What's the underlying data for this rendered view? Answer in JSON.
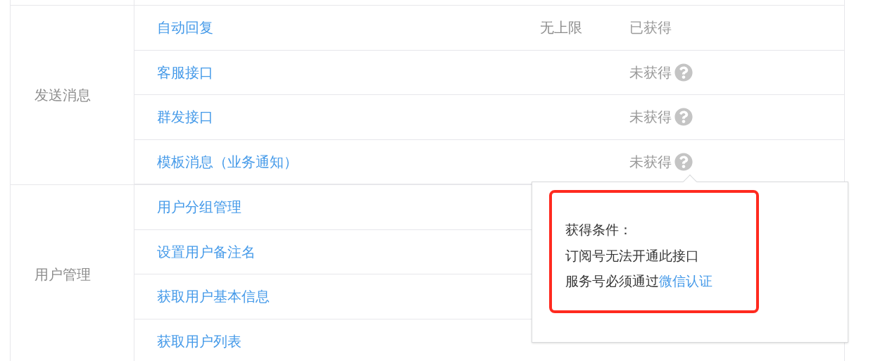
{
  "groups": [
    {
      "category": "发送消息",
      "features": [
        {
          "name": "自动回复",
          "limit": "无上限",
          "status": "已获得",
          "obtained": true
        },
        {
          "name": "客服接口",
          "status": "未获得",
          "obtained": false
        },
        {
          "name": "群发接口",
          "status": "未获得",
          "obtained": false
        },
        {
          "name": "模板消息（业务通知）",
          "status": "未获得",
          "obtained": false
        }
      ]
    },
    {
      "category": "用户管理",
      "features": [
        {
          "name": "用户分组管理"
        },
        {
          "name": "设置用户备注名"
        },
        {
          "name": "获取用户基本信息"
        },
        {
          "name": "获取用户列表"
        }
      ]
    }
  ],
  "popover": {
    "title": "获得条件：",
    "lines": [
      {
        "text": "订阅号无法开通此接口"
      },
      {
        "text": "服务号必须通过",
        "link": "微信认证"
      }
    ],
    "highlighted": true
  }
}
